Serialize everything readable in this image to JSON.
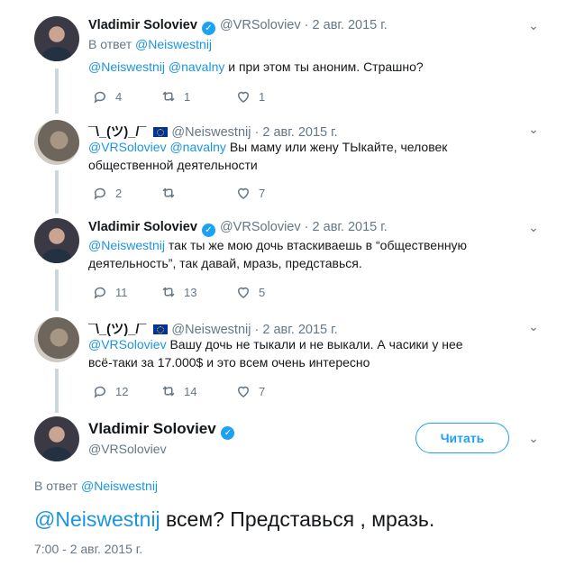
{
  "tweets": [
    {
      "name": "Vladimir Soloviev",
      "handle": "@VRSoloviev",
      "date": "2 авг. 2015 г.",
      "reply_prefix": "В ответ",
      "reply_to": "@Neiswestnij",
      "mentions": "@Neiswestnij @navalny",
      "text": " и при этом ты аноним. Страшно?",
      "replies": "4",
      "retweets": "1",
      "likes": "1"
    },
    {
      "name": "¯\\_(ツ)_/¯",
      "handle": "@Neiswestnij",
      "date": "2 авг. 2015 г.",
      "mentions": "@VRSoloviev @navalny",
      "text": " Вы маму или жену ТЫкайте, человек общественной деятельности",
      "replies": "2",
      "retweets": "",
      "likes": "7"
    },
    {
      "name": "Vladimir Soloviev",
      "handle": "@VRSoloviev",
      "date": "2 авг. 2015 г.",
      "mentions": "@Neiswestnij",
      "text": " так ты же мою дочь втаскиваешь в “общественную деятельность”,  так давай, мразь, представься.",
      "replies": "11",
      "retweets": "13",
      "likes": "5"
    },
    {
      "name": "¯\\_(ツ)_/¯",
      "handle": "@Neiswestnij",
      "date": "2 авг. 2015 г.",
      "mentions": "@VRSoloviev",
      "text": " Вашу дочь не тыкали и не выкали. А часики у нее всё-таки за 17.000$ и это всем очень интересно",
      "replies": "12",
      "retweets": "14",
      "likes": "7"
    }
  ],
  "main": {
    "name": "Vladimir Soloviev",
    "handle": "@VRSoloviev",
    "follow_label": "Читать",
    "reply_prefix": "В ответ",
    "reply_to": "@Neiswestnij",
    "mention": "@Neiswestnij",
    "text": " всем? Представься , мразь.",
    "timestamp": "7:00 - 2 авг. 2015 г."
  },
  "separator": "·",
  "verified_glyph": "✓",
  "caret_glyph": "⌄",
  "colors": {
    "link": "#1b95e0",
    "accent": "#1da1f2",
    "muted": "#657786"
  }
}
